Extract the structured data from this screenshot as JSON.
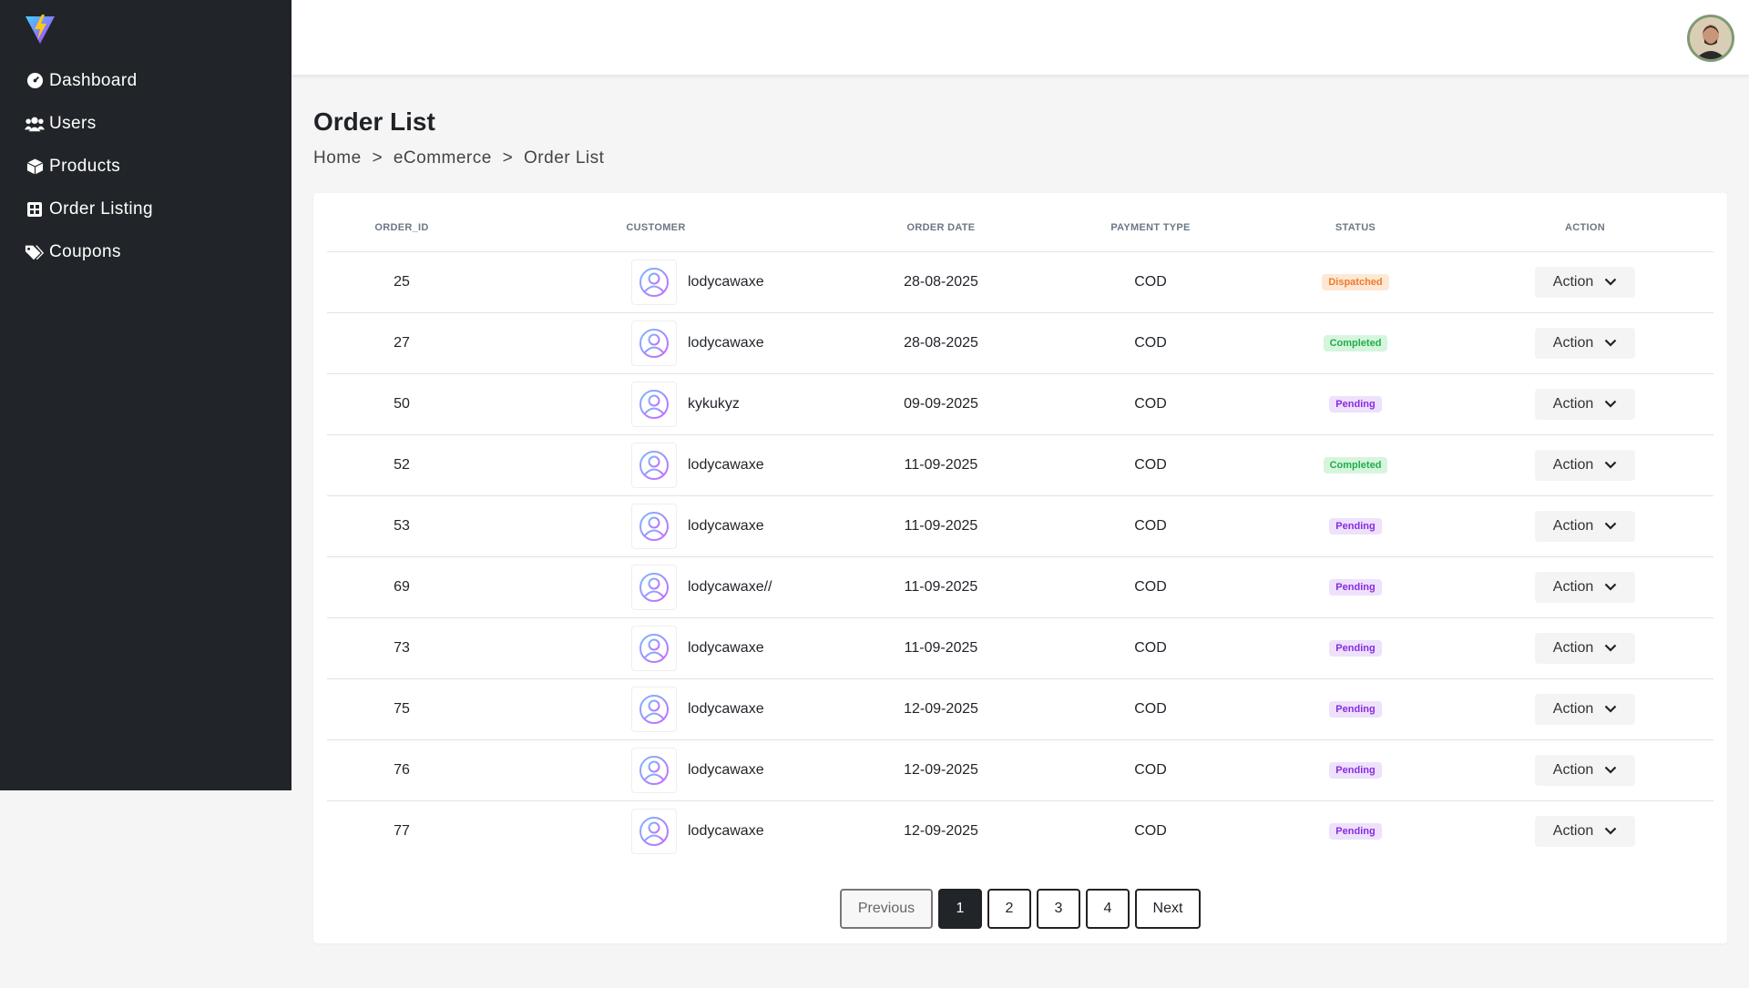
{
  "sidebar": {
    "items": [
      {
        "label": "Dashboard",
        "icon": "dashboard-icon"
      },
      {
        "label": "Users",
        "icon": "users-icon"
      },
      {
        "label": "Products",
        "icon": "box-icon"
      },
      {
        "label": "Order Listing",
        "icon": "grid-icon"
      },
      {
        "label": "Coupons",
        "icon": "tags-icon"
      }
    ]
  },
  "page": {
    "title": "Order List",
    "breadcrumb": [
      "Home",
      ">",
      "eCommerce",
      ">",
      "Order List"
    ]
  },
  "table": {
    "headers": [
      "ORDER_ID",
      "CUSTOMER",
      "ORDER DATE",
      "PAYMENT TYPE",
      "STATUS",
      "ACTION"
    ],
    "rows": [
      {
        "id": "25",
        "customer": "lodycawaxe",
        "date": "28-08-2025",
        "payment": "COD",
        "status": "Dispatched",
        "action": "Action"
      },
      {
        "id": "27",
        "customer": "lodycawaxe",
        "date": "28-08-2025",
        "payment": "COD",
        "status": "Completed",
        "action": "Action"
      },
      {
        "id": "50",
        "customer": "kykukyz",
        "date": "09-09-2025",
        "payment": "COD",
        "status": "Pending",
        "action": "Action"
      },
      {
        "id": "52",
        "customer": "lodycawaxe",
        "date": "11-09-2025",
        "payment": "COD",
        "status": "Completed",
        "action": "Action"
      },
      {
        "id": "53",
        "customer": "lodycawaxe",
        "date": "11-09-2025",
        "payment": "COD",
        "status": "Pending",
        "action": "Action"
      },
      {
        "id": "69",
        "customer": "lodycawaxe//",
        "date": "11-09-2025",
        "payment": "COD",
        "status": "Pending",
        "action": "Action"
      },
      {
        "id": "73",
        "customer": "lodycawaxe",
        "date": "11-09-2025",
        "payment": "COD",
        "status": "Pending",
        "action": "Action"
      },
      {
        "id": "75",
        "customer": "lodycawaxe",
        "date": "12-09-2025",
        "payment": "COD",
        "status": "Pending",
        "action": "Action"
      },
      {
        "id": "76",
        "customer": "lodycawaxe",
        "date": "12-09-2025",
        "payment": "COD",
        "status": "Pending",
        "action": "Action"
      },
      {
        "id": "77",
        "customer": "lodycawaxe",
        "date": "12-09-2025",
        "payment": "COD",
        "status": "Pending",
        "action": "Action"
      }
    ]
  },
  "pagination": {
    "previous": "Previous",
    "pages": [
      "1",
      "2",
      "3",
      "4"
    ],
    "active": "1",
    "next": "Next"
  },
  "colors": {
    "sidebar_bg": "#212529",
    "dispatched": "#f07a2a",
    "completed": "#1fae4a",
    "pending": "#8a2be2"
  }
}
